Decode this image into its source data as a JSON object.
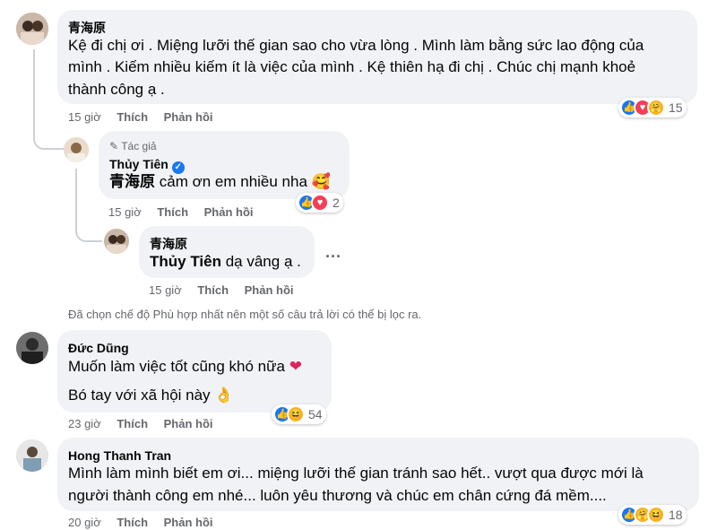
{
  "comments": [
    {
      "author": "青海原",
      "lines": [
        "Kệ đi chị ơi . Miệng lưỡi thế gian sao cho vừa lòng . Mình làm bằng sức lao động của",
        "mình . Kiếm nhiều kiếm ít là việc của mình . Kệ thiên hạ đi chị . Chúc chị mạnh khoẻ",
        "thành công ạ ."
      ],
      "time": "15 giờ",
      "like_label": "Thích",
      "reply_label": "Phản hồi",
      "reactions": [
        "like",
        "love",
        "care"
      ],
      "reaction_count": "15"
    },
    {
      "author_badge": "Tác giả",
      "author": "Thủy Tiên",
      "mention": "青海原",
      "text": "cảm ơn em nhiều nha",
      "time": "15 giờ",
      "like_label": "Thích",
      "reply_label": "Phản hồi",
      "reactions": [
        "like",
        "love"
      ],
      "reaction_count": "2"
    },
    {
      "author": "青海原",
      "mention": "Thủy Tiên",
      "text": "dạ vâng ạ .",
      "time": "15 giờ",
      "like_label": "Thích",
      "reply_label": "Phản hồi",
      "more_label": "..."
    },
    {
      "author": "Đức Dũng",
      "lines": [
        "Muốn làm việc tốt cũng khó nữa",
        "Bó tay với xã hội này"
      ],
      "time": "23 giờ",
      "like_label": "Thích",
      "reply_label": "Phản hồi",
      "reactions": [
        "like",
        "haha"
      ],
      "reaction_count": "54"
    },
    {
      "author": "Hong Thanh Tran",
      "lines": [
        "Mình làm mình biết em ơi... miệng lưỡi thế gian tránh sao hết.. vượt qua được mới là",
        "người thành công em nhé... luôn yêu thương và chúc em chân cứng đá mềm...."
      ],
      "time": "20 giờ",
      "like_label": "Thích",
      "reply_label": "Phản hồi",
      "reactions": [
        "like",
        "care",
        "haha"
      ],
      "reaction_count": "18"
    }
  ],
  "filter_notice": "Đã chọn chế độ Phù hợp nhất nên một số câu trả lời có thể bị lọc ra.",
  "colors": {
    "like": "#1877f2",
    "love": "#f33e58",
    "care": "#f7b125",
    "bubble": "#f0f2f5",
    "meta": "#65676b"
  }
}
